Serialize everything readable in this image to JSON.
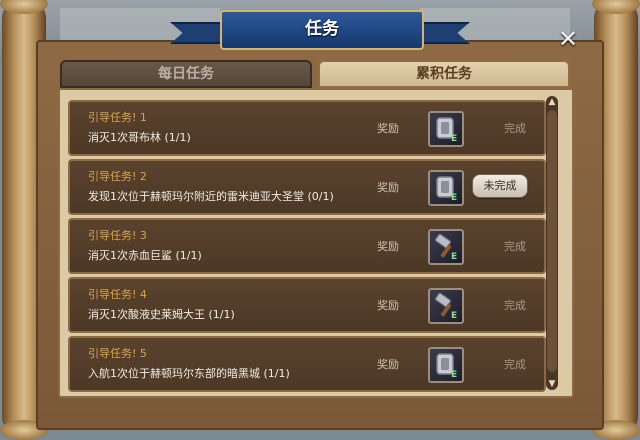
{
  "window": {
    "title": "任务",
    "close_glyph": "✕"
  },
  "tabs": [
    {
      "label": "每日任务",
      "active": false
    },
    {
      "label": "累积任务",
      "active": true
    }
  ],
  "quests": [
    {
      "name": "引导任务! 1",
      "desc": "消灭1次哥布林 (1/1)",
      "reward_label": "奖励",
      "reward_icon": "armor-plate-icon",
      "status": "完成",
      "status_kind": "text"
    },
    {
      "name": "引导任务! 2",
      "desc": "发现1次位于赫顿玛尔附近的雷米迪亚大圣堂 (0/1)",
      "reward_label": "奖励",
      "reward_icon": "armor-plate-icon",
      "status": "未完成",
      "status_kind": "button"
    },
    {
      "name": "引导任务! 3",
      "desc": "消灭1次赤血巨鲨 (1/1)",
      "reward_label": "奖励",
      "reward_icon": "hammer-icon",
      "status": "完成",
      "status_kind": "text"
    },
    {
      "name": "引导任务! 4",
      "desc": "消灭1次酸液史莱姆大王 (1/1)",
      "reward_label": "奖励",
      "reward_icon": "hammer-icon",
      "status": "完成",
      "status_kind": "text"
    },
    {
      "name": "引导任务! 5",
      "desc": "入航1次位于赫顿玛尔东部的暗黑城 (1/1)",
      "reward_label": "奖励",
      "reward_icon": "armor-plate-icon",
      "status": "完成",
      "status_kind": "text"
    }
  ],
  "icon_badge": "E",
  "colors": {
    "quest_name": "#d9a54e",
    "ribbon": "#1e4580",
    "panel": "#7a5838"
  }
}
